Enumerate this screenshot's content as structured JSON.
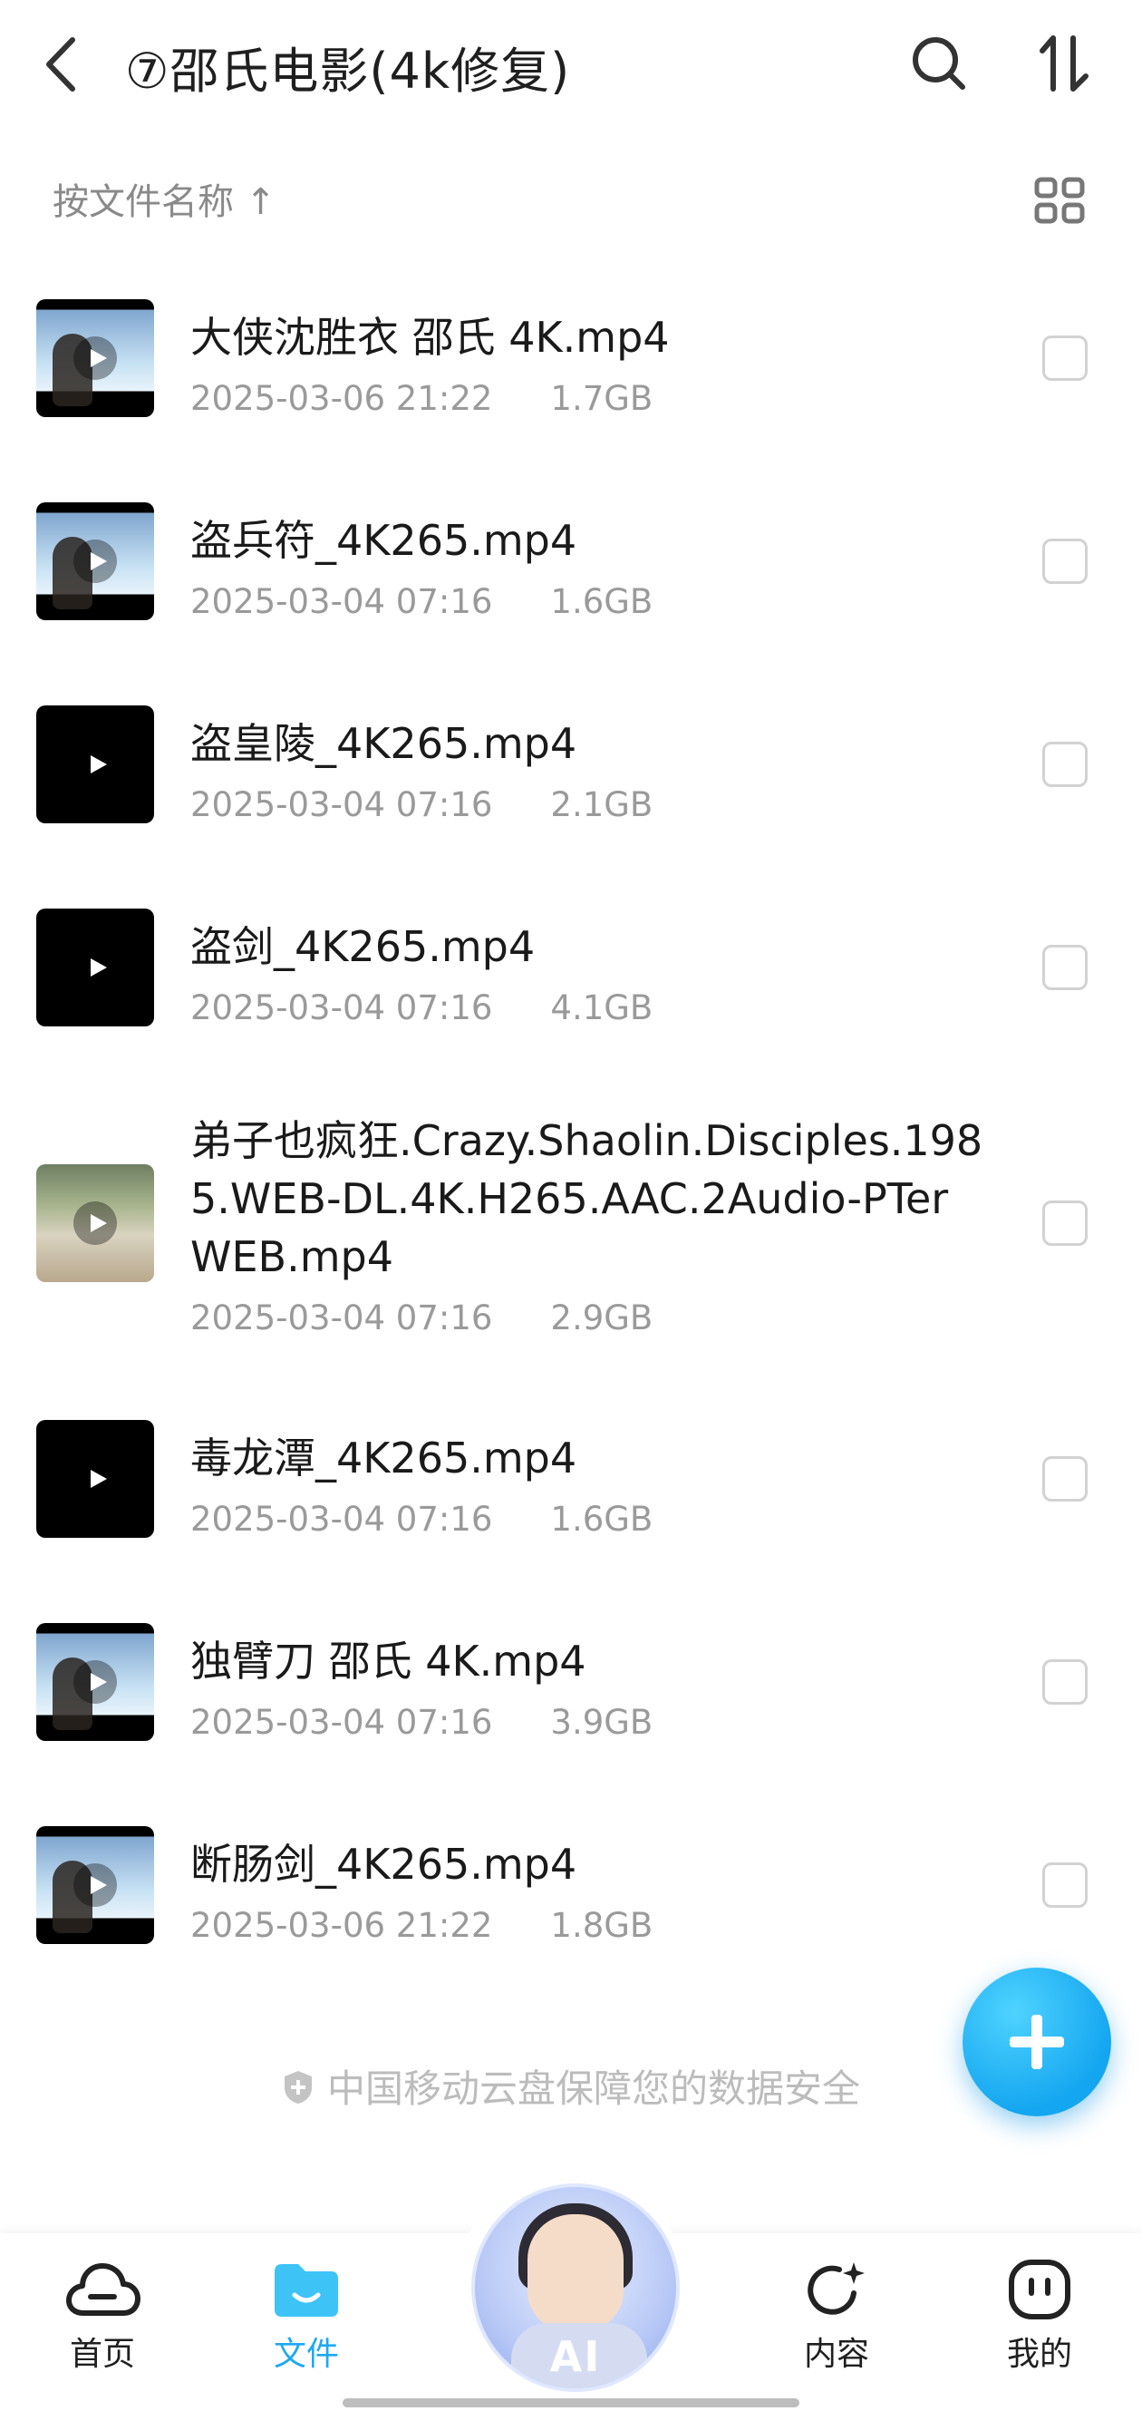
{
  "header": {
    "title": "⑦邵氏电影(4k修复)"
  },
  "sort": {
    "label": "按文件名称 ↑"
  },
  "files": [
    {
      "name": "大侠沈胜衣  邵氏 4K.mp4",
      "date": "2025-03-06 21:22",
      "size": "1.7GB"
    },
    {
      "name": "盗兵符_4K265.mp4",
      "date": "2025-03-04 07:16",
      "size": "1.6GB"
    },
    {
      "name": "盗皇陵_4K265.mp4",
      "date": "2025-03-04 07:16",
      "size": "2.1GB"
    },
    {
      "name": "盗剑_4K265.mp4",
      "date": "2025-03-04 07:16",
      "size": "4.1GB"
    },
    {
      "name": "弟子也疯狂.Crazy.Shaolin.Disciples.1985.WEB-DL.4K.H265.AAC.2Audio-PTerWEB.mp4",
      "date": "2025-03-04 07:16",
      "size": "2.9GB"
    },
    {
      "name": "毒龙潭_4K265.mp4",
      "date": "2025-03-04 07:16",
      "size": "1.6GB"
    },
    {
      "name": "独臂刀  邵氏  4K.mp4",
      "date": "2025-03-04 07:16",
      "size": "3.9GB"
    },
    {
      "name": "断肠剑_4K265.mp4",
      "date": "2025-03-06 21:22",
      "size": "1.8GB"
    }
  ],
  "footer": {
    "security": "中国移动云盘保障您的数据安全"
  },
  "tabs": {
    "home": "首页",
    "files": "文件",
    "ai": "AI",
    "content": "内容",
    "mine": "我的"
  },
  "colors": {
    "accent": "#1ea9f0"
  }
}
